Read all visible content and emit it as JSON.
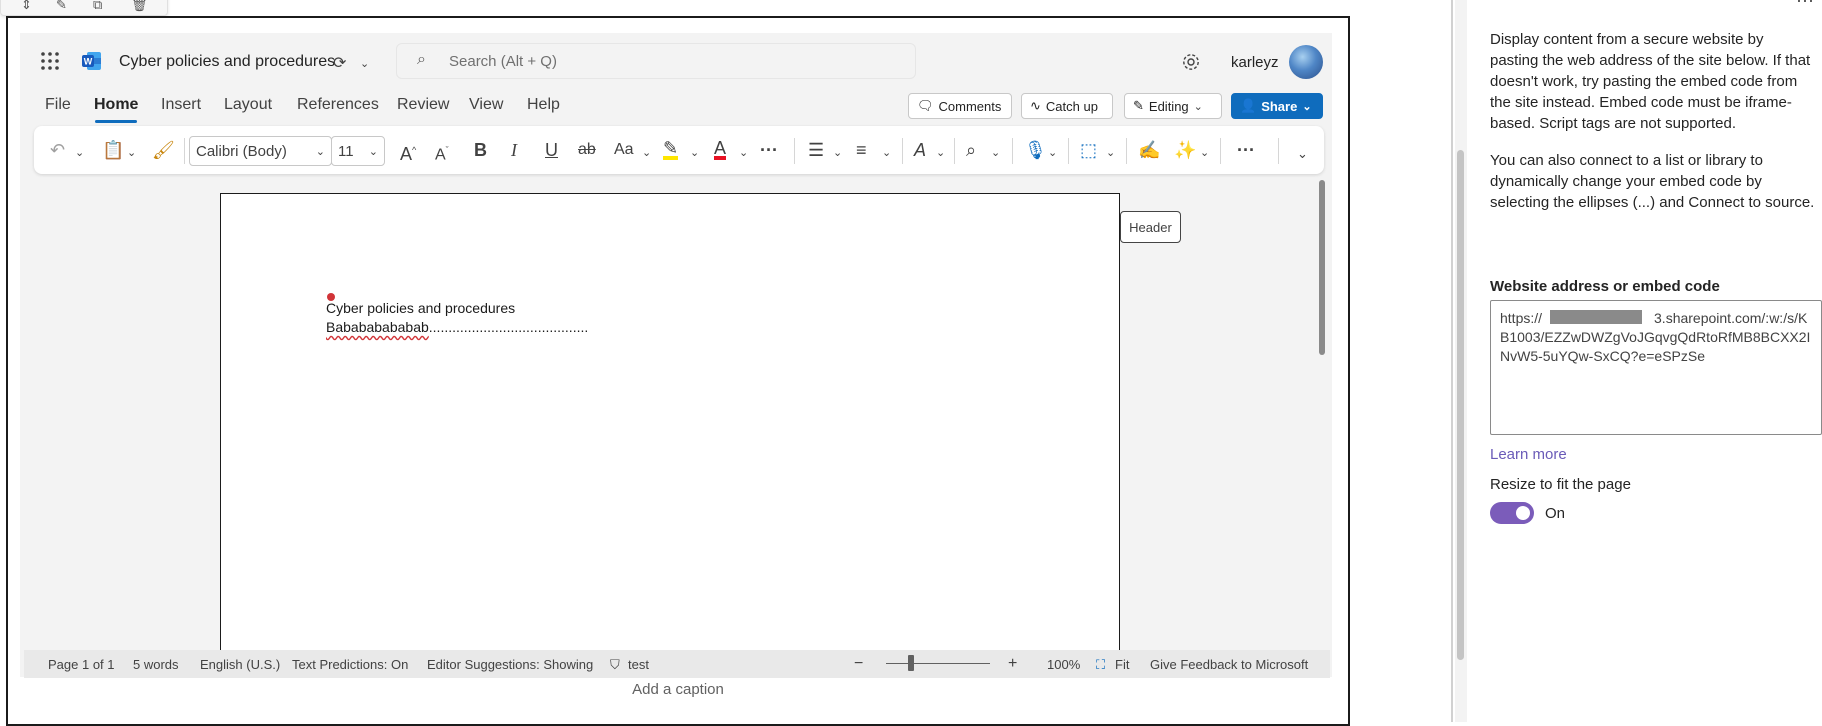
{
  "word": {
    "doc_title": "Cyber policies and procedures",
    "search_placeholder": "Search (Alt + Q)",
    "username": "karleyz",
    "menu_tabs": [
      "File",
      "Home",
      "Insert",
      "Layout",
      "References",
      "Review",
      "View",
      "Help"
    ],
    "active_tab": "Home",
    "comments_label": "Comments",
    "catchup_label": "Catch up",
    "editing_label": "Editing",
    "share_label": "Share",
    "font_name": "Calibri (Body)",
    "font_size": "11",
    "ribbon_letters": {
      "bold": "B",
      "italic": "I",
      "underline": "U",
      "strike": "ab",
      "change_case": "Aa"
    },
    "header_tag": "Header",
    "doc_lines": [
      "Cyber policies and procedures",
      "Babababababab",
      "........................................."
    ],
    "status": {
      "page": "Page 1 of 1",
      "words": "5 words",
      "language": "English (U.S.)",
      "text_predictions": "Text Predictions: On",
      "editor_suggestions": "Editor Suggestions: Showing",
      "sensitivity": "test",
      "zoom": "100%",
      "fit": "Fit",
      "feedback": "Give Feedback to Microsoft"
    },
    "zoom_fraction": 0.22
  },
  "caption_placeholder": "Add a caption",
  "panel": {
    "description_1": "Display content from a secure website by pasting the web address of the site below. If that doesn't work, try pasting the embed code from the site instead. Embed code must be iframe-based. Script tags are not supported.",
    "description_2": "You can also connect to a list or library to dynamically change your embed code by selecting the ellipses (...) and Connect to source.",
    "field_label": "Website address or embed code",
    "field_value": "https://        3.sharepoint.com/:w:/s/KB1003/EZZwDWZgVoJGqvgQdRtoRfMB8BCXX2INvW5-5uYQw-SxCQ?e=eSPzSe",
    "learn_more": "Learn more",
    "resize_label": "Resize to fit the page",
    "resize_state": "On",
    "resize_on": true
  },
  "colors": {
    "accent_blue": "#0f6cbd",
    "toggle_purple": "#7b5cba",
    "highlight_yellow": "#ffe600",
    "font_red": "#e81123",
    "word_blue": "#185abd"
  }
}
